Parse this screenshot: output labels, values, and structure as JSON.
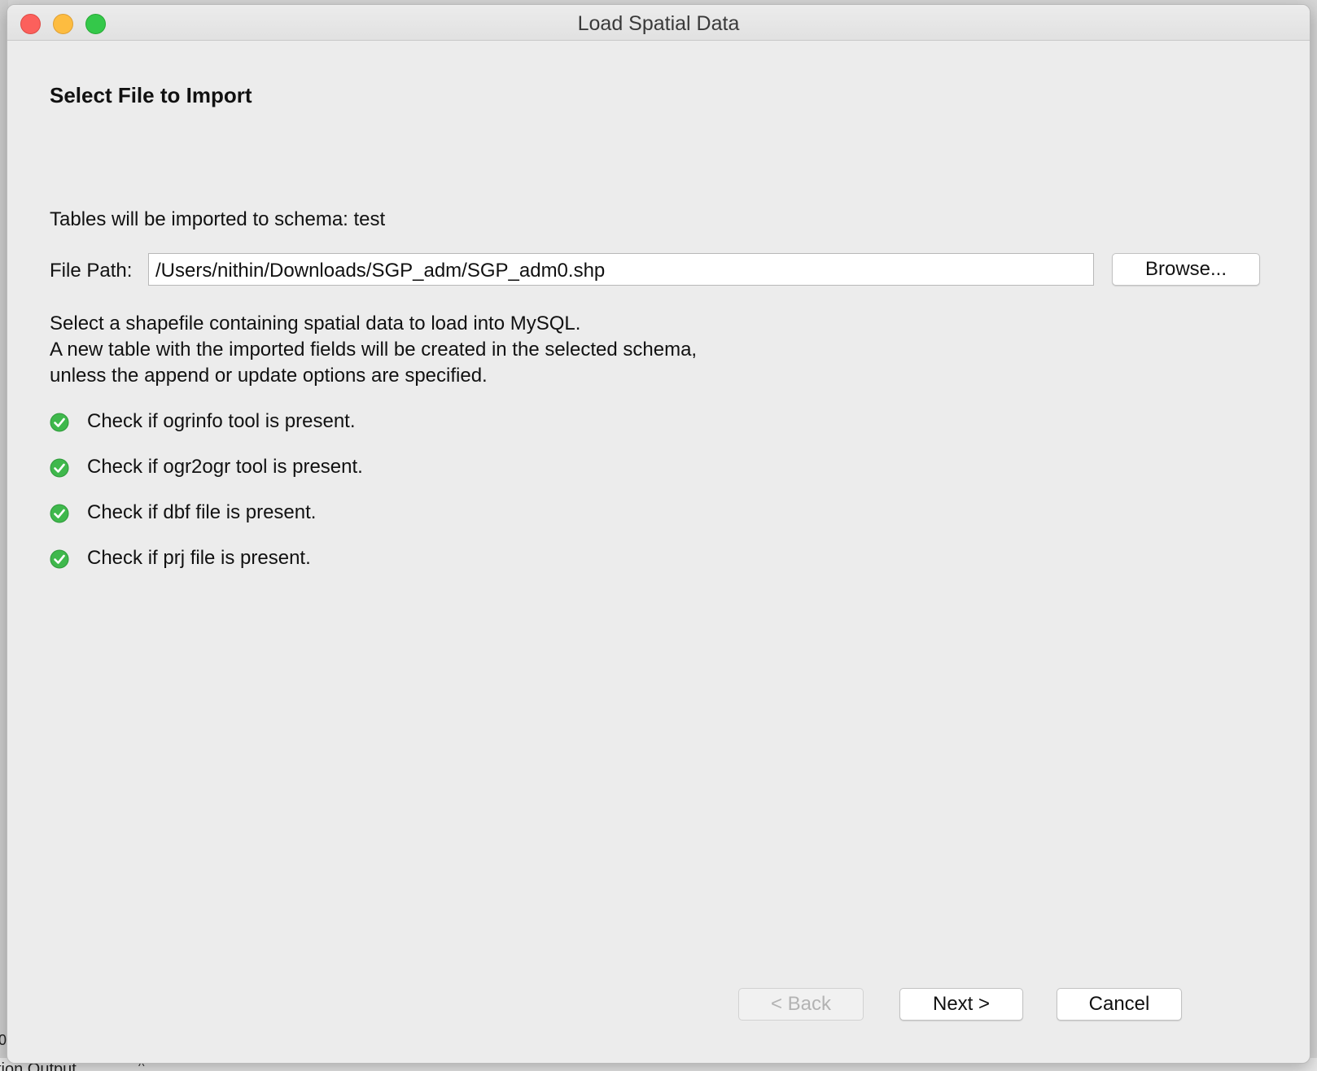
{
  "window": {
    "title": "Load Spatial Data"
  },
  "page": {
    "heading": "Select File to Import",
    "schema_line": "Tables will be imported to schema: test",
    "file_path_label": "File Path:",
    "file_path_value": "/Users/nithin/Downloads/SGP_adm/SGP_adm0.shp",
    "browse_label": "Browse...",
    "description": [
      "Select a shapefile containing spatial data to load into MySQL.",
      "A new table with the imported fields will be created in the selected schema,",
      "unless the append or update options are specified."
    ],
    "checks": [
      {
        "label": "Check if ogrinfo tool is present.",
        "status": "ok",
        "icon": "check-circle-icon"
      },
      {
        "label": "Check if ogr2ogr tool is present.",
        "status": "ok",
        "icon": "check-circle-icon"
      },
      {
        "label": "Check if dbf file is present.",
        "status": "ok",
        "icon": "check-circle-icon"
      },
      {
        "label": "Check if prj file is present.",
        "status": "ok",
        "icon": "check-circle-icon"
      }
    ]
  },
  "footer": {
    "back_label": "< Back",
    "next_label": "Next >",
    "cancel_label": "Cancel",
    "back_enabled": false
  },
  "background": {
    "partial_text": "tion Output",
    "partial_number": "0"
  },
  "colors": {
    "check_green": "#3fb84c",
    "close": "#fc605c",
    "minimize": "#fdbc40",
    "maximize": "#34c84a"
  }
}
